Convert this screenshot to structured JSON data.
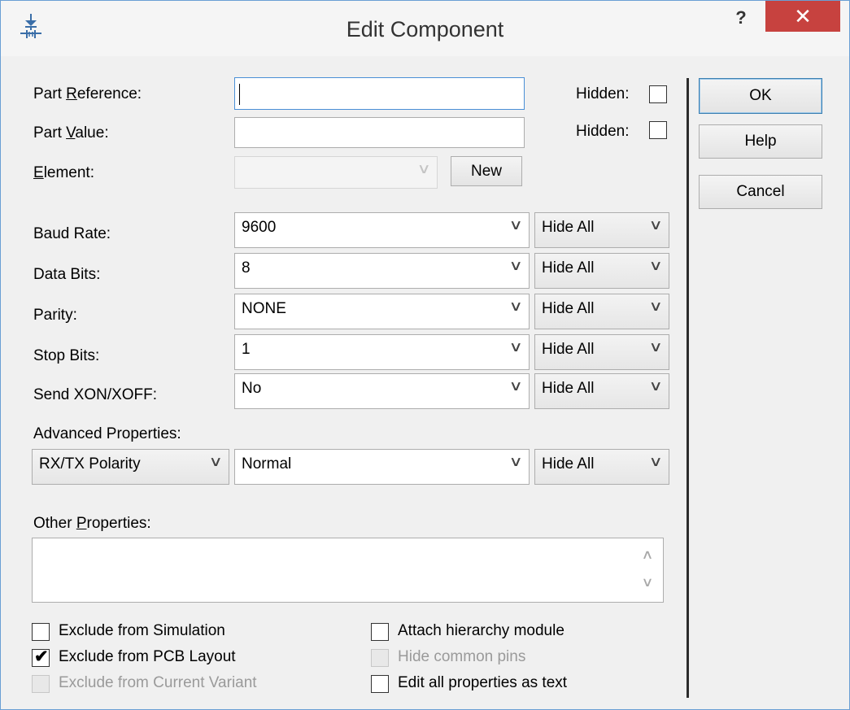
{
  "window": {
    "title": "Edit Component",
    "help_glyph": "?",
    "close_glyph": "✕",
    "icon": "component-diode-icon"
  },
  "fields": {
    "part_reference": {
      "label_pre": "Part ",
      "label_ul": "R",
      "label_post": "eference:",
      "value": ""
    },
    "part_value": {
      "label_pre": "Part ",
      "label_ul": "V",
      "label_post": "alue:",
      "value": ""
    },
    "hidden_label": "Hidden:",
    "element": {
      "label_ul": "E",
      "label_post": "lement:",
      "value": "",
      "new_button": "New"
    }
  },
  "properties": [
    {
      "label": "Baud Rate:",
      "value": "9600",
      "visibility": "Hide All"
    },
    {
      "label": "Data Bits:",
      "value": "8",
      "visibility": "Hide All"
    },
    {
      "label": "Parity:",
      "value": "NONE",
      "visibility": "Hide All"
    },
    {
      "label": "Stop Bits:",
      "value": "1",
      "visibility": "Hide All"
    },
    {
      "label": "Send XON/XOFF:",
      "value": "No",
      "visibility": "Hide All"
    }
  ],
  "advanced": {
    "label": "Advanced Properties:",
    "property": "RX/TX Polarity",
    "value": "Normal",
    "visibility": "Hide All"
  },
  "other": {
    "label_pre": "Other ",
    "label_ul": "P",
    "label_post": "roperties:",
    "value": ""
  },
  "options": {
    "exclude_simulation": {
      "label": "Exclude from Simulation",
      "checked": false,
      "enabled": true
    },
    "exclude_pcb": {
      "label": "Exclude from PCB Layout",
      "checked": true,
      "enabled": true
    },
    "exclude_variant": {
      "label": "Exclude from Current Variant",
      "checked": false,
      "enabled": false
    },
    "attach_hierarchy": {
      "label": "Attach hierarchy module",
      "checked": false,
      "enabled": true
    },
    "hide_common_pins": {
      "label": "Hide common pins",
      "checked": false,
      "enabled": false
    },
    "edit_as_text": {
      "label": "Edit all properties as text",
      "checked": false,
      "enabled": true
    }
  },
  "buttons": {
    "ok": "OK",
    "help": "Help",
    "cancel": "Cancel"
  },
  "arrow_glyph": "∨",
  "scroll": {
    "up": "∧",
    "down": "∨"
  }
}
